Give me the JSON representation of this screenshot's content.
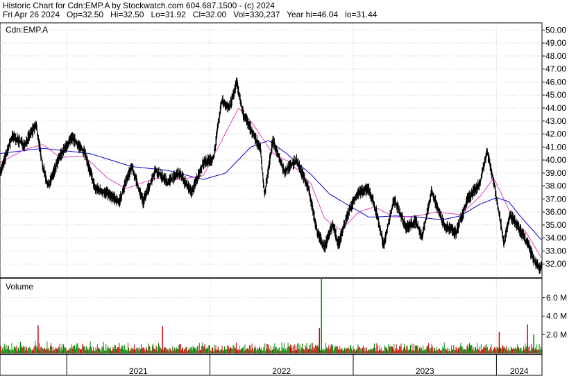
{
  "header": {
    "line1": "Historic Chart for Cdn:EMP.A by Stockwatch.com 604.687.1500 - (c) 2024",
    "line2": "Fri Apr 26 2024   Op=32.50   Hi=32.50   Lo=31.92   Cl=32.00   Vol=330,237   Year hi=46.04   lo=31.44"
  },
  "chart_data": [
    {
      "type": "line",
      "title": "Cdn:EMP.A",
      "ylim": [
        31,
        50.5
      ],
      "yticks": [
        "50.00",
        "49.00",
        "48.00",
        "47.00",
        "46.00",
        "45.00",
        "44.00",
        "43.00",
        "42.00",
        "41.00",
        "40.00",
        "39.00",
        "38.00",
        "37.00",
        "36.00",
        "35.00",
        "34.00",
        "33.00",
        "32.00"
      ],
      "x_range": [
        "2020-07-15",
        "2024-04-26"
      ],
      "grid": true,
      "series": [
        {
          "kind": "price",
          "color": "#000000",
          "points": [
            [
              "2020-07-15",
              38.9
            ],
            [
              "2020-08-15",
              41.8
            ],
            [
              "2020-09-15",
              41.2
            ],
            [
              "2020-10-15",
              42.7
            ],
            [
              "2020-11-01",
              39.5
            ],
            [
              "2020-11-15",
              38.0
            ],
            [
              "2020-12-15",
              40.3
            ],
            [
              "2021-01-15",
              41.7
            ],
            [
              "2021-02-15",
              40.6
            ],
            [
              "2021-03-15",
              37.8
            ],
            [
              "2021-04-15",
              37.4
            ],
            [
              "2021-05-15",
              36.8
            ],
            [
              "2021-06-15",
              39.5
            ],
            [
              "2021-07-15",
              36.8
            ],
            [
              "2021-08-15",
              39.2
            ],
            [
              "2021-09-15",
              38.3
            ],
            [
              "2021-10-15",
              39.0
            ],
            [
              "2021-11-15",
              37.5
            ],
            [
              "2021-12-15",
              39.8
            ],
            [
              "2022-01-10",
              40.1
            ],
            [
              "2022-01-31",
              44.6
            ],
            [
              "2022-02-20",
              44.0
            ],
            [
              "2022-03-10",
              46.0
            ],
            [
              "2022-03-25",
              43.7
            ],
            [
              "2022-04-15",
              42.4
            ],
            [
              "2022-05-10",
              40.8
            ],
            [
              "2022-05-20",
              37.3
            ],
            [
              "2022-06-10",
              41.5
            ],
            [
              "2022-07-10",
              39.1
            ],
            [
              "2022-08-10",
              40.0
            ],
            [
              "2022-09-10",
              37.7
            ],
            [
              "2022-10-01",
              34.5
            ],
            [
              "2022-10-20",
              33.3
            ],
            [
              "2022-11-10",
              35.0
            ],
            [
              "2022-11-25",
              33.5
            ],
            [
              "2022-12-15",
              35.6
            ],
            [
              "2023-01-10",
              37.4
            ],
            [
              "2023-02-10",
              37.8
            ],
            [
              "2023-03-01",
              36.0
            ],
            [
              "2023-03-20",
              33.4
            ],
            [
              "2023-04-15",
              37.0
            ],
            [
              "2023-05-15",
              34.8
            ],
            [
              "2023-06-10",
              35.3
            ],
            [
              "2023-06-25",
              34.0
            ],
            [
              "2023-07-20",
              37.6
            ],
            [
              "2023-08-20",
              35.0
            ],
            [
              "2023-09-20",
              34.4
            ],
            [
              "2023-10-20",
              37.0
            ],
            [
              "2023-11-20",
              38.2
            ],
            [
              "2023-12-08",
              40.7
            ],
            [
              "2023-12-25",
              38.4
            ],
            [
              "2024-01-10",
              35.5
            ],
            [
              "2024-01-20",
              33.6
            ],
            [
              "2024-02-05",
              35.8
            ],
            [
              "2024-03-01",
              34.6
            ],
            [
              "2024-03-20",
              33.6
            ],
            [
              "2024-04-05",
              32.3
            ],
            [
              "2024-04-20",
              31.6
            ],
            [
              "2024-04-26",
              32.0
            ]
          ]
        },
        {
          "kind": "moving-average-short",
          "color": "#e040c0",
          "points": [
            [
              "2020-07-15",
              39.8
            ],
            [
              "2020-09-15",
              40.8
            ],
            [
              "2020-11-01",
              41.2
            ],
            [
              "2020-12-15",
              40.2
            ],
            [
              "2021-02-15",
              40.3
            ],
            [
              "2021-04-15",
              38.6
            ],
            [
              "2021-06-01",
              37.8
            ],
            [
              "2021-08-15",
              38.6
            ],
            [
              "2021-10-15",
              38.5
            ],
            [
              "2021-12-15",
              38.8
            ],
            [
              "2022-01-31",
              41.5
            ],
            [
              "2022-03-15",
              44.0
            ],
            [
              "2022-04-15",
              43.0
            ],
            [
              "2022-06-10",
              40.5
            ],
            [
              "2022-07-25",
              39.8
            ],
            [
              "2022-09-15",
              38.2
            ],
            [
              "2022-10-20",
              35.5
            ],
            [
              "2022-12-01",
              34.6
            ],
            [
              "2023-01-15",
              36.0
            ],
            [
              "2023-02-25",
              36.4
            ],
            [
              "2023-04-15",
              35.6
            ],
            [
              "2023-06-15",
              35.7
            ],
            [
              "2023-08-01",
              36.0
            ],
            [
              "2023-10-01",
              35.8
            ],
            [
              "2023-11-20",
              37.2
            ],
            [
              "2023-12-25",
              38.6
            ],
            [
              "2024-01-20",
              37.0
            ],
            [
              "2024-02-15",
              35.3
            ],
            [
              "2024-03-15",
              34.5
            ],
            [
              "2024-04-26",
              32.4
            ]
          ]
        },
        {
          "kind": "moving-average-long",
          "color": "#0000cc",
          "points": [
            [
              "2020-07-15",
              40.5
            ],
            [
              "2020-11-01",
              40.9
            ],
            [
              "2021-03-01",
              40.5
            ],
            [
              "2021-06-15",
              39.5
            ],
            [
              "2021-09-15",
              39.2
            ],
            [
              "2021-12-15",
              38.5
            ],
            [
              "2022-02-10",
              39.0
            ],
            [
              "2022-04-15",
              41.0
            ],
            [
              "2022-05-31",
              41.5
            ],
            [
              "2022-07-15",
              40.5
            ],
            [
              "2022-09-15",
              38.9
            ],
            [
              "2022-11-01",
              37.4
            ],
            [
              "2022-12-15",
              36.6
            ],
            [
              "2023-02-10",
              35.6
            ],
            [
              "2023-04-20",
              35.7
            ],
            [
              "2023-06-15",
              35.6
            ],
            [
              "2023-08-15",
              35.4
            ],
            [
              "2023-10-01",
              35.7
            ],
            [
              "2023-11-20",
              36.6
            ],
            [
              "2024-01-01",
              37.1
            ],
            [
              "2024-02-01",
              36.8
            ],
            [
              "2024-03-01",
              35.7
            ],
            [
              "2024-04-26",
              33.8
            ]
          ]
        }
      ]
    },
    {
      "type": "bar",
      "title": "Volume",
      "ylim": [
        0,
        8.0
      ],
      "yticks": [
        "6.0 M",
        "4.0 M",
        "2.0 M"
      ],
      "spikes": [
        {
          "date": "2020-09-05",
          "value": 1.2,
          "color": "#008800"
        },
        {
          "date": "2020-10-20",
          "value": 3.0,
          "color": "#cc0000"
        },
        {
          "date": "2021-09-02",
          "value": 2.9,
          "color": "#cc0000"
        },
        {
          "date": "2022-10-07",
          "value": 2.7,
          "color": "#cc0000"
        },
        {
          "date": "2022-10-12",
          "value": 8.2,
          "color": "#008800"
        },
        {
          "date": "2024-01-08",
          "value": 2.3,
          "color": "#cc0000"
        },
        {
          "date": "2024-03-20",
          "value": 3.1,
          "color": "#cc0000"
        },
        {
          "date": "2024-04-05",
          "value": 2.0,
          "color": "#008800"
        }
      ],
      "baseline_range": [
        0.2,
        1.3
      ],
      "up_color": "#008800",
      "down_color": "#cc0000"
    }
  ],
  "x_axis": {
    "years": [
      {
        "label": "2021",
        "start": "2021-01-01"
      },
      {
        "label": "2022",
        "start": "2022-01-01"
      },
      {
        "label": "2023",
        "start": "2023-01-01"
      },
      {
        "label": "2024",
        "start": "2024-01-01"
      }
    ]
  }
}
